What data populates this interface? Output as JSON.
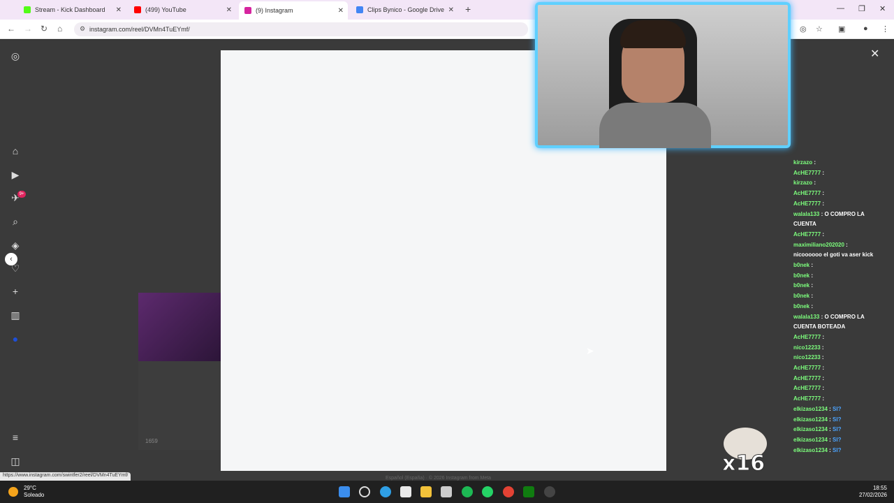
{
  "tabs": [
    {
      "title": "Stream - Kick Dashboard",
      "color": "#53fc18"
    },
    {
      "title": "(499) YouTube",
      "color": "#ff0000"
    },
    {
      "title": "(9) Instagram",
      "color": "#d6249f"
    },
    {
      "title": "Clips Bynico - Google Drive",
      "color": "#4285f4"
    }
  ],
  "address": {
    "url": "instagram.com/reel/DVMn4TuEYmf/"
  },
  "instagram": {
    "notification_badge": "9+",
    "footer": "Español (España)  ·  © 2026 Instagram from Meta",
    "thumb_views": "1659"
  },
  "chat": {
    "messages": [
      {
        "user": "kirzazo",
        "text": ""
      },
      {
        "user": "AcHE7777",
        "text": ""
      },
      {
        "user": "kirzazo",
        "text": ""
      },
      {
        "user": "AcHE7777",
        "text": ""
      },
      {
        "user": "AcHE7777",
        "text": ""
      },
      {
        "user": "walala133",
        "text": "O COMPRO LA"
      },
      {
        "user": "",
        "text": "CUENTA"
      },
      {
        "user": "AcHE7777",
        "text": ""
      },
      {
        "user": "maximiliano202020",
        "text": ""
      },
      {
        "user": "",
        "text": "nicoooooo el goti va aser kick"
      },
      {
        "user": "b0nek",
        "text": ""
      },
      {
        "user": "b0nek",
        "text": ""
      },
      {
        "user": "b0nek",
        "text": ""
      },
      {
        "user": "b0nek",
        "text": ""
      },
      {
        "user": "b0nek",
        "text": ""
      },
      {
        "user": "walala133",
        "text": "O COMPRO LA"
      },
      {
        "user": "",
        "text": "CUENTA BOTEADA"
      },
      {
        "user": "AcHE7777",
        "text": ""
      },
      {
        "user": "nico12233",
        "text": ""
      },
      {
        "user": "nico12233",
        "text": ""
      },
      {
        "user": "AcHE7777",
        "text": ""
      },
      {
        "user": "AcHE7777",
        "text": ""
      },
      {
        "user": "AcHE7777",
        "text": ""
      },
      {
        "user": "AcHE7777",
        "text": ""
      },
      {
        "user": "",
        "text": ""
      },
      {
        "user": "elkizaso1234",
        "text": "SI?"
      },
      {
        "user": "elkizaso1234",
        "text": "SI?"
      },
      {
        "user": "elkizaso1234",
        "text": "SI?"
      },
      {
        "user": "elkizaso1234",
        "text": "SI?"
      },
      {
        "user": "",
        "text": ""
      },
      {
        "user": "elkizaso1234",
        "text": "SI?"
      }
    ]
  },
  "overlay": {
    "combo": "x16"
  },
  "status_url": "https://www.instagram.com/swintfer2/reel/DVMn4TuEYmf/",
  "taskbar": {
    "temp": "29°C",
    "condition": "Soleado",
    "time": "18:55",
    "date": "27/02/2026"
  }
}
